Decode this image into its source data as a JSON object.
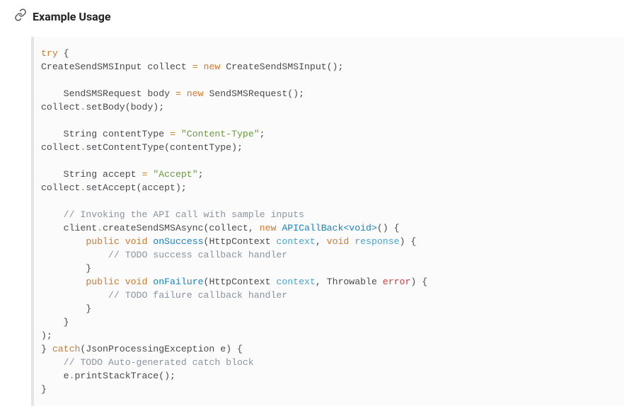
{
  "header": {
    "icon_name": "link-icon",
    "title": "Example Usage"
  },
  "code": {
    "tokens": [
      {
        "t": "try",
        "c": "kw"
      },
      {
        "t": " {",
        "c": "pn"
      },
      {
        "t": "\n",
        "c": "nl"
      },
      {
        "t": "CreateSendSMSInput collect ",
        "c": "pn"
      },
      {
        "t": "=",
        "c": "op"
      },
      {
        "t": " ",
        "c": "pn"
      },
      {
        "t": "new",
        "c": "kw"
      },
      {
        "t": " CreateSendSMSInput();",
        "c": "pn"
      },
      {
        "t": "\n",
        "c": "nl"
      },
      {
        "t": "\n",
        "c": "nl"
      },
      {
        "t": "    SendSMSRequest body ",
        "c": "pn"
      },
      {
        "t": "=",
        "c": "op"
      },
      {
        "t": " ",
        "c": "pn"
      },
      {
        "t": "new",
        "c": "kw"
      },
      {
        "t": " SendSMSRequest();",
        "c": "pn"
      },
      {
        "t": "\n",
        "c": "nl"
      },
      {
        "t": "collect",
        "c": "pn"
      },
      {
        "t": ".",
        "c": "op"
      },
      {
        "t": "setBody(body);",
        "c": "pn"
      },
      {
        "t": "\n",
        "c": "nl"
      },
      {
        "t": "\n",
        "c": "nl"
      },
      {
        "t": "    String contentType ",
        "c": "pn"
      },
      {
        "t": "=",
        "c": "op"
      },
      {
        "t": " ",
        "c": "pn"
      },
      {
        "t": "\"Content-Type\"",
        "c": "str"
      },
      {
        "t": ";",
        "c": "pn"
      },
      {
        "t": "\n",
        "c": "nl"
      },
      {
        "t": "collect",
        "c": "pn"
      },
      {
        "t": ".",
        "c": "op"
      },
      {
        "t": "setContentType(contentType);",
        "c": "pn"
      },
      {
        "t": "\n",
        "c": "nl"
      },
      {
        "t": "\n",
        "c": "nl"
      },
      {
        "t": "    String accept ",
        "c": "pn"
      },
      {
        "t": "=",
        "c": "op"
      },
      {
        "t": " ",
        "c": "pn"
      },
      {
        "t": "\"Accept\"",
        "c": "str"
      },
      {
        "t": ";",
        "c": "pn"
      },
      {
        "t": "\n",
        "c": "nl"
      },
      {
        "t": "collect",
        "c": "pn"
      },
      {
        "t": ".",
        "c": "op"
      },
      {
        "t": "setAccept(accept);",
        "c": "pn"
      },
      {
        "t": "\n",
        "c": "nl"
      },
      {
        "t": "\n",
        "c": "nl"
      },
      {
        "t": "    ",
        "c": "pn"
      },
      {
        "t": "// Invoking the API call with sample inputs",
        "c": "com"
      },
      {
        "t": "\n",
        "c": "nl"
      },
      {
        "t": "    client",
        "c": "pn"
      },
      {
        "t": ".",
        "c": "op"
      },
      {
        "t": "createSendSMSAsync(collect, ",
        "c": "pn"
      },
      {
        "t": "new",
        "c": "kw"
      },
      {
        "t": " ",
        "c": "pn"
      },
      {
        "t": "APICallBack<void>",
        "c": "type"
      },
      {
        "t": "() {",
        "c": "pn"
      },
      {
        "t": "\n",
        "c": "nl"
      },
      {
        "t": "        ",
        "c": "pn"
      },
      {
        "t": "public",
        "c": "kw"
      },
      {
        "t": " ",
        "c": "pn"
      },
      {
        "t": "void",
        "c": "kw"
      },
      {
        "t": " ",
        "c": "pn"
      },
      {
        "t": "onSuccess",
        "c": "fn"
      },
      {
        "t": "(HttpContext ",
        "c": "pn"
      },
      {
        "t": "context",
        "c": "var"
      },
      {
        "t": ", ",
        "c": "pn"
      },
      {
        "t": "void",
        "c": "kw"
      },
      {
        "t": " ",
        "c": "pn"
      },
      {
        "t": "response",
        "c": "var"
      },
      {
        "t": ") {",
        "c": "pn"
      },
      {
        "t": "\n",
        "c": "nl"
      },
      {
        "t": "            ",
        "c": "pn"
      },
      {
        "t": "// TODO success callback handler",
        "c": "com"
      },
      {
        "t": "\n",
        "c": "nl"
      },
      {
        "t": "        }",
        "c": "pn"
      },
      {
        "t": "\n",
        "c": "nl"
      },
      {
        "t": "        ",
        "c": "pn"
      },
      {
        "t": "public",
        "c": "kw"
      },
      {
        "t": " ",
        "c": "pn"
      },
      {
        "t": "void",
        "c": "kw"
      },
      {
        "t": " ",
        "c": "pn"
      },
      {
        "t": "onFailure",
        "c": "fn"
      },
      {
        "t": "(HttpContext ",
        "c": "pn"
      },
      {
        "t": "context",
        "c": "var"
      },
      {
        "t": ", Throwable ",
        "c": "pn"
      },
      {
        "t": "error",
        "c": "err"
      },
      {
        "t": ") {",
        "c": "pn"
      },
      {
        "t": "\n",
        "c": "nl"
      },
      {
        "t": "            ",
        "c": "pn"
      },
      {
        "t": "// TODO failure callback handler",
        "c": "com"
      },
      {
        "t": "\n",
        "c": "nl"
      },
      {
        "t": "        }",
        "c": "pn"
      },
      {
        "t": "\n",
        "c": "nl"
      },
      {
        "t": "    }",
        "c": "pn"
      },
      {
        "t": "\n",
        "c": "nl"
      },
      {
        "t": ");",
        "c": "pn"
      },
      {
        "t": "\n",
        "c": "nl"
      },
      {
        "t": "} ",
        "c": "pn"
      },
      {
        "t": "catch",
        "c": "kw"
      },
      {
        "t": "(JsonProcessingException e) {",
        "c": "pn"
      },
      {
        "t": "\n",
        "c": "nl"
      },
      {
        "t": "    ",
        "c": "pn"
      },
      {
        "t": "// TODO Auto-generated catch block",
        "c": "com"
      },
      {
        "t": "\n",
        "c": "nl"
      },
      {
        "t": "    e",
        "c": "pn"
      },
      {
        "t": ".",
        "c": "op"
      },
      {
        "t": "printStackTrace();",
        "c": "pn"
      },
      {
        "t": "\n",
        "c": "nl"
      },
      {
        "t": "}",
        "c": "pn"
      }
    ]
  }
}
